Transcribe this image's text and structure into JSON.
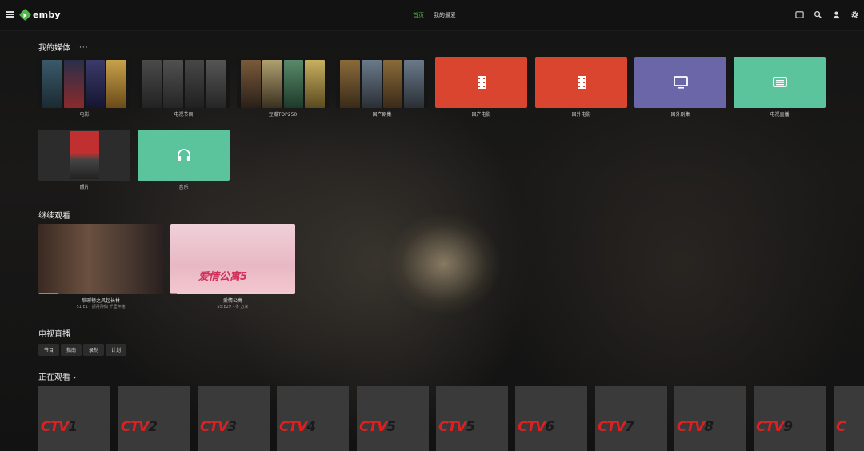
{
  "header": {
    "app_name": "emby",
    "tabs": [
      {
        "label": "首页",
        "active": true
      },
      {
        "label": "我的最爱",
        "active": false
      }
    ],
    "accent_color": "#52b54b"
  },
  "my_media": {
    "title": "我的媒体",
    "more_label": "···",
    "libraries": [
      {
        "label": "电影"
      },
      {
        "label": "电视节目"
      },
      {
        "label": "豆瓣TOP250"
      },
      {
        "label": "国产剧集"
      },
      {
        "label": "国产电影",
        "icon": "film-icon",
        "color": "#d9452f"
      },
      {
        "label": "国外电影",
        "icon": "film-icon",
        "color": "#d9452f"
      },
      {
        "label": "国外剧集",
        "icon": "tv-icon",
        "color": "#6b66a8"
      },
      {
        "label": "电视直播",
        "icon": "live-tv-icon",
        "color": "#5cc49d"
      },
      {
        "label": "照片"
      },
      {
        "label": "音乐",
        "icon": "headphones-icon",
        "color": "#5cc49d"
      }
    ]
  },
  "continue_watching": {
    "title": "继续观看",
    "items": [
      {
        "title": "琅琊榜之风起长林",
        "subtitle": "S1:E1 - 振丹孙仙 千里奔驰",
        "progress": 0.15
      },
      {
        "title": "爱情公寓",
        "subtitle": "S5:E29 - 冬 万家",
        "progress": 0.05
      }
    ]
  },
  "live_tv": {
    "title": "电视直播",
    "buttons": [
      "节目",
      "指南",
      "录制",
      "计划"
    ]
  },
  "now_watching": {
    "title": "正在观看 ›",
    "channels": [
      {
        "logo": "CTV",
        "num": "1"
      },
      {
        "logo": "CTV",
        "num": "2"
      },
      {
        "logo": "CTV",
        "num": "3"
      },
      {
        "logo": "CTV",
        "num": "4"
      },
      {
        "logo": "CTV",
        "num": "5"
      },
      {
        "logo": "CTV",
        "num": "5"
      },
      {
        "logo": "CTV",
        "num": "6"
      },
      {
        "logo": "CTV",
        "num": "7"
      },
      {
        "logo": "CTV",
        "num": "8"
      },
      {
        "logo": "CTV",
        "num": "9"
      },
      {
        "logo": "C",
        "num": ""
      }
    ]
  }
}
